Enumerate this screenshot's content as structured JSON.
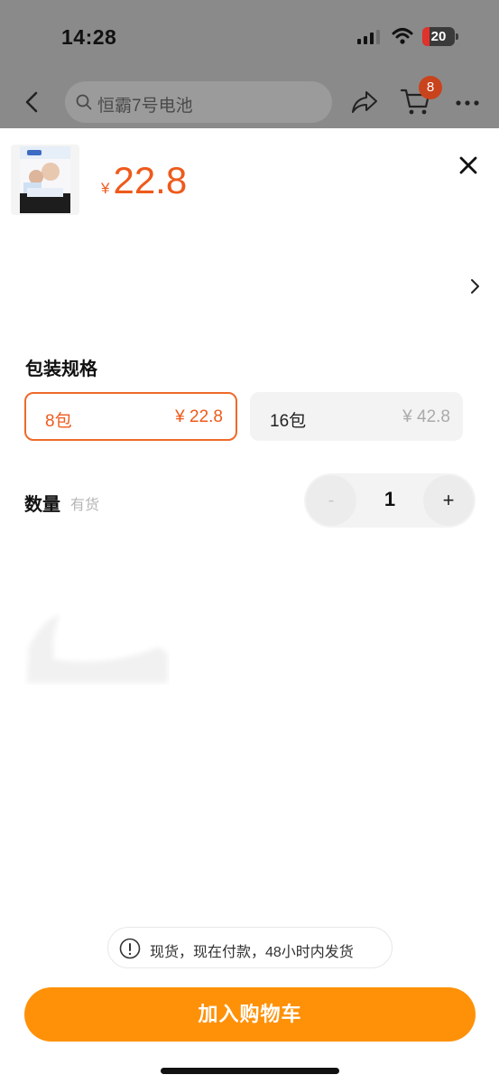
{
  "status_bar": {
    "time": "14:28",
    "battery": "20"
  },
  "nav": {
    "search_placeholder": "恒霸7号电池",
    "cart_count": "8"
  },
  "product": {
    "price_symbol": "¥",
    "price": "22.8"
  },
  "spec": {
    "title": "包装规格",
    "options": [
      {
        "name": "8包",
        "price": "¥ 22.8",
        "selected": true
      },
      {
        "name": "16包",
        "price": "¥ 42.8",
        "selected": false
      }
    ]
  },
  "quantity": {
    "label": "数量",
    "stock": "有货",
    "minus": "-",
    "value": "1",
    "plus": "+"
  },
  "notice": {
    "text": "现货，现在付款，48小时内发货"
  },
  "footer": {
    "add_to_cart": "加入购物车"
  },
  "colors": {
    "accent": "#ee5a1b",
    "button": "#ff9108"
  },
  "icons": [
    "back-icon",
    "search-icon",
    "share-icon",
    "cart-icon",
    "more-icon",
    "close-icon",
    "chevron-right-icon",
    "info-icon",
    "signal-icon",
    "wifi-icon"
  ]
}
